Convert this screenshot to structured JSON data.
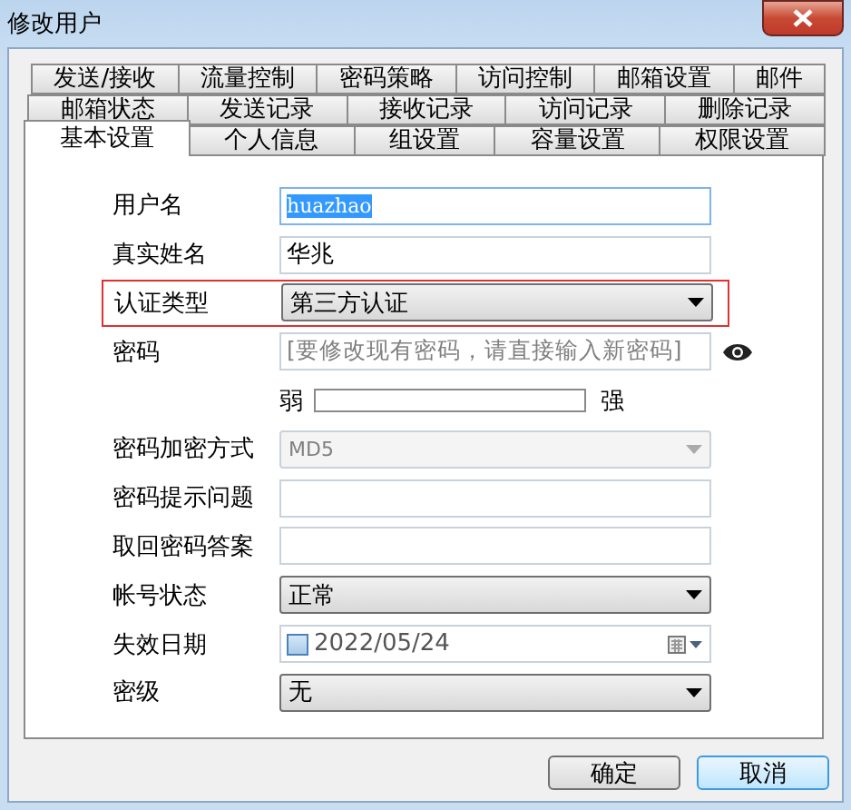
{
  "window": {
    "title": "修改用户"
  },
  "tab_rows": [
    [
      {
        "label": "发送/接收",
        "selected": false
      },
      {
        "label": "流量控制",
        "selected": false
      },
      {
        "label": "密码策略",
        "selected": false
      },
      {
        "label": "访问控制",
        "selected": false
      },
      {
        "label": "邮箱设置",
        "selected": false
      },
      {
        "label": "邮件",
        "selected": false
      }
    ],
    [
      {
        "label": "邮箱状态",
        "selected": false
      },
      {
        "label": "发送记录",
        "selected": false
      },
      {
        "label": "接收记录",
        "selected": false
      },
      {
        "label": "访问记录",
        "selected": false
      },
      {
        "label": "删除记录",
        "selected": false
      }
    ],
    [
      {
        "label": "基本设置",
        "selected": true
      },
      {
        "label": "个人信息",
        "selected": false
      },
      {
        "label": "组设置",
        "selected": false
      },
      {
        "label": "容量设置",
        "selected": false
      },
      {
        "label": "权限设置",
        "selected": false
      }
    ]
  ],
  "fields": [
    {
      "kind": "text",
      "label": "用户名",
      "value": "huazhao",
      "text_selected": true
    },
    {
      "kind": "text",
      "label": "真实姓名",
      "value": "华兆"
    },
    {
      "kind": "select",
      "label": "认证类型",
      "value": "第三方认证",
      "highlighted": true
    },
    {
      "kind": "password",
      "label": "密码",
      "placeholder": "[要修改现有密码，请直接输入新密码]"
    },
    {
      "kind": "strength",
      "weak_label": "弱",
      "strong_label": "强",
      "level": 0
    },
    {
      "kind": "select",
      "label": "密码加密方式",
      "value": "MD5",
      "disabled": true
    },
    {
      "kind": "text",
      "label": "密码提示问题"
    },
    {
      "kind": "text",
      "label": "取回密码答案"
    },
    {
      "kind": "select",
      "label": "帐号状态",
      "value": "正常"
    },
    {
      "kind": "date",
      "label": "失效日期",
      "value": "2022/05/24",
      "checked": false
    },
    {
      "kind": "select",
      "label": "密级",
      "value": "无"
    }
  ],
  "buttons": [
    {
      "label": "确定",
      "focused": false
    },
    {
      "label": "取消",
      "focused": true
    }
  ]
}
